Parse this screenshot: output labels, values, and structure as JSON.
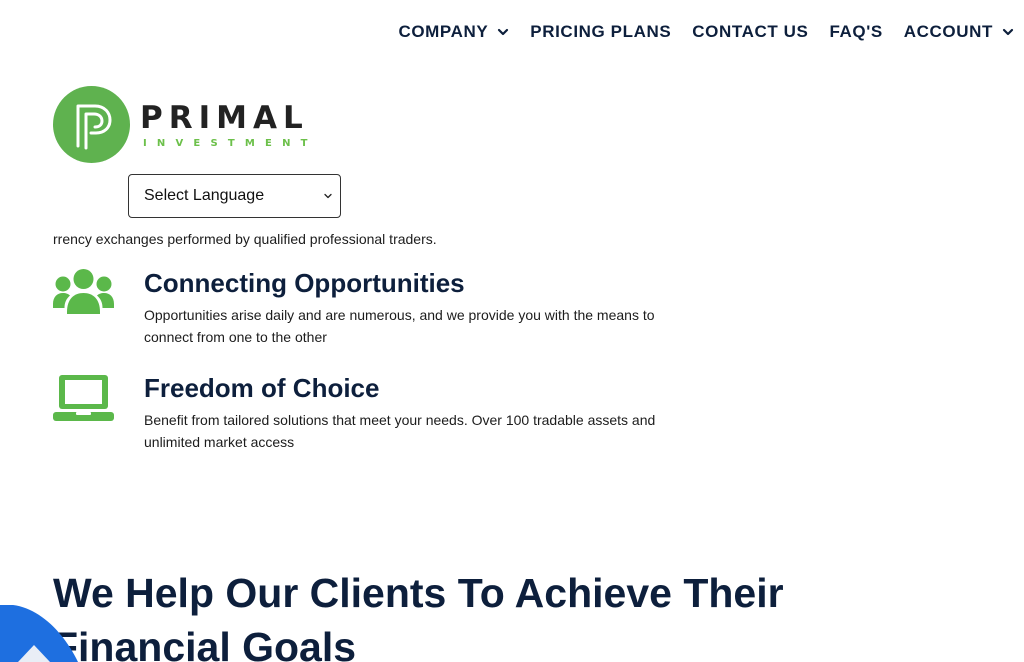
{
  "nav": {
    "items": [
      {
        "label": "COMPANY",
        "has_dropdown": true
      },
      {
        "label": "PRICING PLANS",
        "has_dropdown": false
      },
      {
        "label": "CONTACT US",
        "has_dropdown": false
      },
      {
        "label": "FAQ'S",
        "has_dropdown": false
      },
      {
        "label": "ACCOUNT",
        "has_dropdown": true
      }
    ]
  },
  "logo": {
    "name": "PRIMAL",
    "sub": "INVESTMENT",
    "icon": "p-letter-logo-icon"
  },
  "language_select": {
    "value": "Select Language",
    "icon": "chevron-down-icon"
  },
  "intro": {
    "text": "rrency exchanges performed by qualified professional traders."
  },
  "features": [
    {
      "icon": "users-group-icon",
      "title": "Connecting Opportunities",
      "description": "Opportunities arise daily and are numerous, and we provide you with the means to connect from one to the other"
    },
    {
      "icon": "laptop-icon",
      "title": "Freedom of Choice",
      "description": "Benefit from tailored solutions that meet your needs. Over 100 tradable assets and unlimited market access"
    }
  ],
  "heading": {
    "text": "We Help Our Clients To Achieve Their Financial Goals"
  },
  "colors": {
    "navy": "#0d1f3c",
    "green": "#6cc04a",
    "icon_green": "#5bb84a",
    "deco_blue": "#1e6fe0"
  }
}
